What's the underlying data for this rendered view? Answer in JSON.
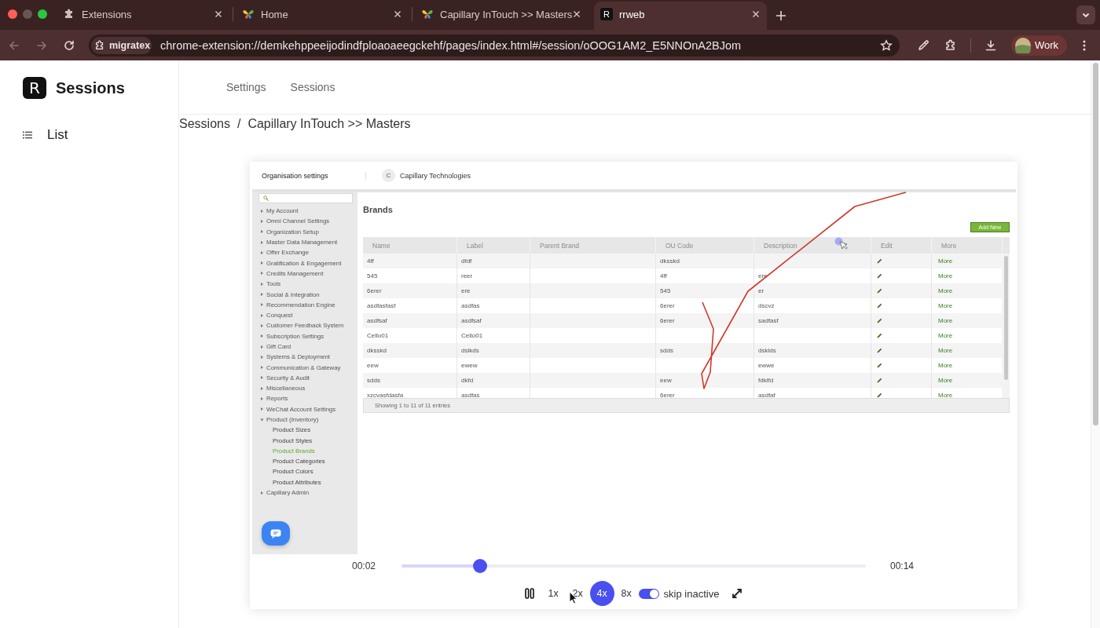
{
  "browser": {
    "tabs": [
      {
        "title": "Extensions",
        "kind": "puzzle",
        "selected": false
      },
      {
        "title": "Home",
        "kind": "butterfly",
        "selected": false
      },
      {
        "title": "Capillary InTouch >> Masters",
        "kind": "butterfly",
        "selected": false
      },
      {
        "title": "rrweb",
        "kind": "letter",
        "icon_letter": "R",
        "selected": true
      }
    ],
    "address_bar": {
      "site_chip": "migratex",
      "url": "chrome-extension://demkehppeeijodindfploaoaeegckehf/pages/index.html#/session/oOOG1AM2_E5NNOnA2BJom"
    },
    "profile": {
      "label": "Work"
    }
  },
  "sidebar": {
    "logo_letter": "R",
    "title": "Sessions",
    "items": [
      {
        "label": "List"
      }
    ]
  },
  "nav": {
    "items": [
      {
        "label": "Settings"
      },
      {
        "label": "Sessions"
      }
    ]
  },
  "breadcrumb": {
    "items": [
      "Sessions",
      "Capillary InTouch >> Masters"
    ],
    "separator": "/"
  },
  "replay": {
    "header": {
      "title": "Organisation settings",
      "org_initial": "C",
      "org_name": "Capillary Technologies"
    },
    "menu": [
      {
        "label": "My Account",
        "expanded": false
      },
      {
        "label": "Omni Channel Settings",
        "expanded": false
      },
      {
        "label": "Organization Setup",
        "expanded": false
      },
      {
        "label": "Master Data Management",
        "expanded": false
      },
      {
        "label": "Offer Exchange",
        "expanded": false
      },
      {
        "label": "Gratification & Engagement",
        "expanded": false
      },
      {
        "label": "Credits Management",
        "expanded": false
      },
      {
        "label": "Tools",
        "expanded": false
      },
      {
        "label": "Social & Integration",
        "expanded": false
      },
      {
        "label": "Recommendation Engine",
        "expanded": false
      },
      {
        "label": "Conquest",
        "expanded": false
      },
      {
        "label": "Customer Feedback System",
        "expanded": false
      },
      {
        "label": "Subscription Settings",
        "expanded": false
      },
      {
        "label": "Gift Card",
        "expanded": false
      },
      {
        "label": "Systems & Deployment",
        "expanded": false
      },
      {
        "label": "Communication & Gateway",
        "expanded": false
      },
      {
        "label": "Security & Audit",
        "expanded": false
      },
      {
        "label": "Miscellaneous",
        "expanded": false
      },
      {
        "label": "Reports",
        "expanded": false
      },
      {
        "label": "WeChat Account Settings",
        "expanded": false
      },
      {
        "label": "Product (Inventory)",
        "expanded": true,
        "children": [
          {
            "label": "Product Sizes",
            "selected": false
          },
          {
            "label": "Product Styles",
            "selected": false
          },
          {
            "label": "Product Brands",
            "selected": true
          },
          {
            "label": "Product Categories",
            "selected": false
          },
          {
            "label": "Product Colors",
            "selected": false
          },
          {
            "label": "Product Attributes",
            "selected": false
          }
        ]
      },
      {
        "label": "Capillary Admin",
        "expanded": false
      }
    ],
    "page_title": "Brands",
    "add_button": "Add New",
    "table": {
      "columns": [
        "Name",
        "Label",
        "Parent Brand",
        "OU Code",
        "Description",
        "Edit",
        "More"
      ],
      "rows": [
        {
          "name": "4ff",
          "label": "dfdf",
          "ou_code": "dksskd",
          "more": "More"
        },
        {
          "name": "545",
          "label": "reer",
          "ou_code": "4ff",
          "description": "ere",
          "more": "More"
        },
        {
          "name": "6erer",
          "label": "ere",
          "ou_code": "545",
          "description": "er",
          "more": "More"
        },
        {
          "name": "asdfasfasf",
          "label": "asdfas",
          "ou_code": "6erer",
          "description": "dscvz",
          "more": "More"
        },
        {
          "name": "asdfsaf",
          "label": "asdfsaf",
          "ou_code": "6erer",
          "description": "sadfasf",
          "more": "More"
        },
        {
          "name": "Cello01",
          "label": "Cello01",
          "more": "More"
        },
        {
          "name": "dksskd",
          "label": "dslkds",
          "ou_code": "sdds",
          "description": "dsklds",
          "more": "More"
        },
        {
          "name": "eew",
          "label": "ewew",
          "description": "ewwe",
          "more": "More"
        },
        {
          "name": "sdds",
          "label": "dkfd",
          "ou_code": "eew",
          "description": "fdklfd",
          "more": "More"
        },
        {
          "name": "xzcvasfdasfa",
          "label": "asdfas",
          "ou_code": "6erer",
          "description": "asdfaf",
          "more": "More"
        }
      ],
      "footer": "Showing 1 to 11 of 11 entries"
    }
  },
  "player": {
    "current_time": "00:02",
    "total_time": "00:14",
    "progress": {
      "level": 0.17
    },
    "playing": true,
    "speeds": [
      {
        "label": "1x",
        "selected": false
      },
      {
        "label": "2x",
        "selected": false
      },
      {
        "label": "4x",
        "selected": true
      },
      {
        "label": "8x",
        "selected": false
      }
    ],
    "skip_inactive": {
      "label": "skip inactive",
      "on": true
    }
  }
}
